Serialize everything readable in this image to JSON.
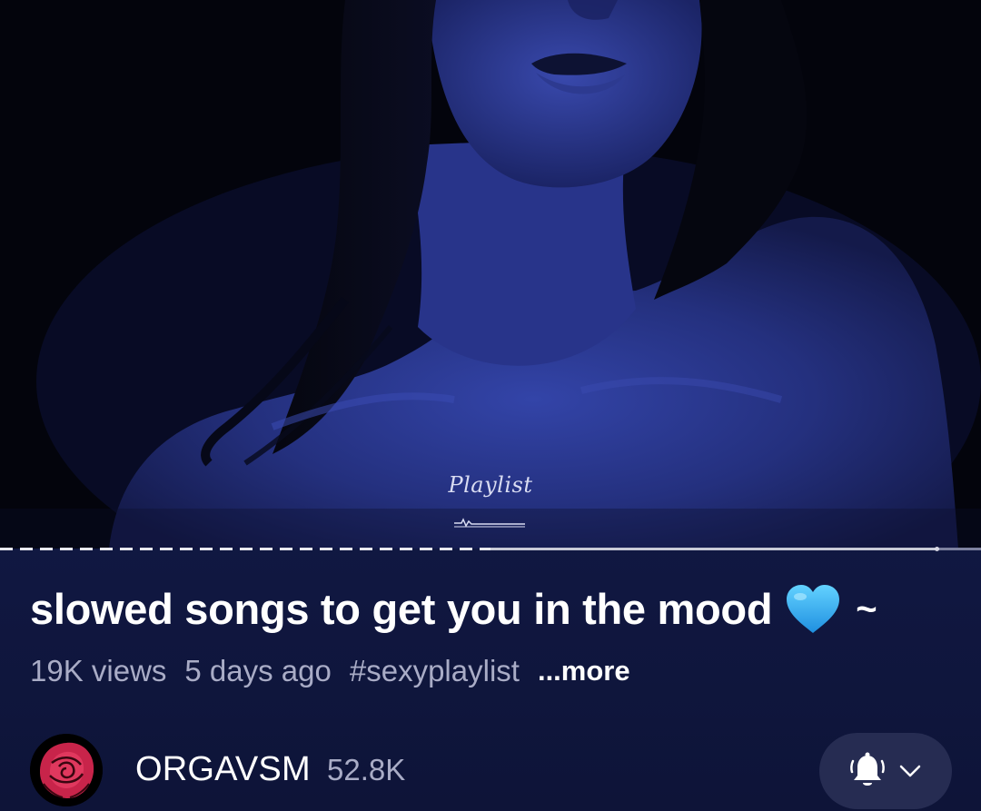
{
  "video": {
    "overlay_caption": "Playlist",
    "progress": {
      "played_fraction": 0.5,
      "buffered_fraction": 0.955
    }
  },
  "details": {
    "title": "slowed songs to get you in the mood",
    "title_emoji": "blue-heart",
    "title_suffix": "~",
    "views": "19K views",
    "age": "5 days ago",
    "hashtag": "#sexyplaylist",
    "more_label": "...more"
  },
  "channel": {
    "name": "ORGAVSM",
    "subscribers": "52.8K",
    "avatar_icon": "red-rose-icon"
  },
  "subscribe_button": {
    "icon": "bell-icon",
    "dropdown_icon": "chevron-down-icon"
  },
  "colors": {
    "background": "#121a48",
    "video_tint": "#2a3aa0",
    "avatar_rose": "#c8244a",
    "bell_button": "#262c52"
  }
}
